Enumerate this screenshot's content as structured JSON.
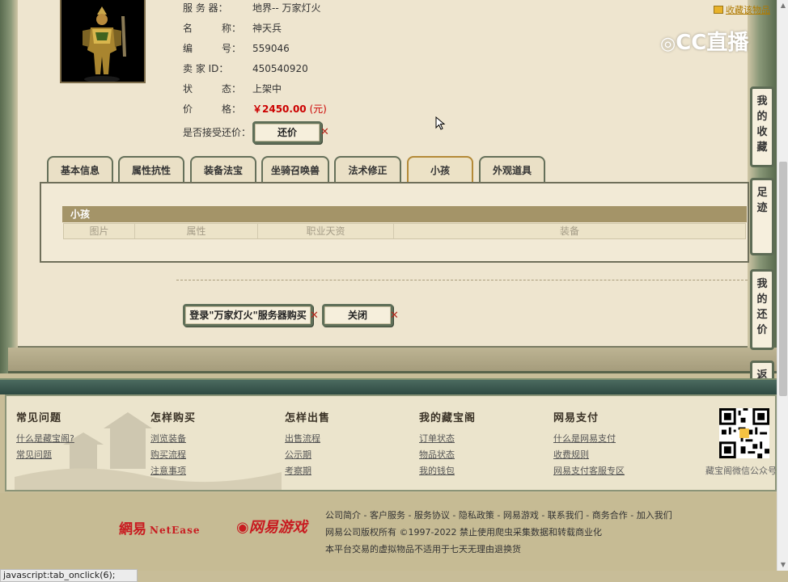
{
  "header": {
    "favorite_link": "收藏该物品",
    "watermark": "CC直播"
  },
  "item": {
    "server_label": "服 务 器：",
    "server_value": "地界-- 万家灯火",
    "name_label": "名　　　称：",
    "name_value": "神天兵",
    "id_label": "编　　　号：",
    "id_value": "559046",
    "seller_label": "卖  家  ID：",
    "seller_value": "450540920",
    "status_label": "状　　　态：",
    "status_value": "上架中",
    "price_label": "价　　　格：",
    "price_value": "￥2450.00",
    "price_unit": "(元)",
    "counter_label": "是否接受还价：",
    "counter_button": "还价"
  },
  "tabs": [
    {
      "label": "基本信息",
      "active": false
    },
    {
      "label": "属性抗性",
      "active": false
    },
    {
      "label": "装备法宝",
      "active": false
    },
    {
      "label": "坐骑召唤兽",
      "active": false
    },
    {
      "label": "法术修正",
      "active": false
    },
    {
      "label": "小孩",
      "active": true
    },
    {
      "label": "外观道具",
      "active": false
    }
  ],
  "child_section": {
    "title": "小孩",
    "columns": [
      "图片",
      "属性",
      "职业天资",
      "装备"
    ]
  },
  "actions": {
    "login_buy": "登录\"万家灯火\"服务器购买",
    "close": "关闭"
  },
  "side_buttons": [
    "我的收藏",
    "足迹",
    "我的还价",
    "返回顶部"
  ],
  "footer": {
    "columns": [
      {
        "title": "常见问题",
        "links": [
          "什么是藏宝阁?",
          "常见问题"
        ]
      },
      {
        "title": "怎样购买",
        "links": [
          "浏览装备",
          "购买流程",
          "注意事项"
        ]
      },
      {
        "title": "怎样出售",
        "links": [
          "出售流程",
          "公示期",
          "考察期"
        ]
      },
      {
        "title": "我的藏宝阁",
        "links": [
          "订单状态",
          "物品状态",
          "我的钱包"
        ]
      },
      {
        "title": "网易支付",
        "links": [
          "什么是网易支付",
          "收费规则",
          "网易支付客服专区"
        ]
      }
    ],
    "qr_caption": "藏宝阁微信公众号"
  },
  "bottom": {
    "logo_netease": "網易",
    "logo_netease_en": "NetEase",
    "logo_games": "网易游戏",
    "links": "公司简介 - 客户服务 - 服务协议 - 隐私政策 - 网易游戏 - 联系我们 - 商务合作 - 加入我们",
    "copyright": "网易公司版权所有 ©1997-2022 禁止使用爬虫采集数据和转载商业化",
    "notice": "本平台交易的虚拟物品不适用于七天无理由退换货"
  },
  "status_bar": "javascript:tab_onclick(6);",
  "colors": {
    "price": "#cc0000",
    "frame": "#5f6f58",
    "active_tab_border": "#b48a38",
    "sub_bar": "#a49468",
    "brand_red": "#c81b20"
  }
}
